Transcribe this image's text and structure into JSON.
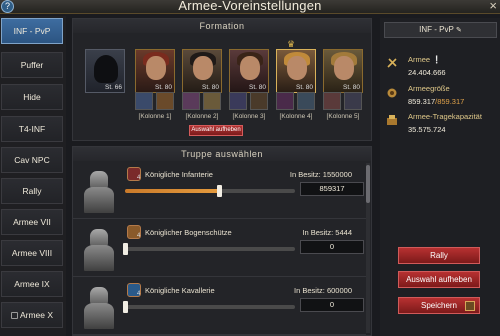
{
  "window": {
    "title": "Armee-Voreinstellungen",
    "help_icon": "?",
    "close_icon": "×"
  },
  "sidebar": {
    "items": [
      {
        "label": "INF - PvP",
        "active": true
      },
      {
        "label": "Puffer"
      },
      {
        "label": "Hide"
      },
      {
        "label": "T4-INF"
      },
      {
        "label": "Cav NPC"
      },
      {
        "label": "Rally"
      },
      {
        "label": "Armee VII"
      },
      {
        "label": "Armee VIII"
      },
      {
        "label": "Armee IX"
      },
      {
        "label": "Armee X",
        "locked": true
      }
    ]
  },
  "formation": {
    "header": "Formation",
    "leader_level": "St. 66",
    "heroes": [
      {
        "level": "St. 80"
      },
      {
        "level": "St. 80"
      },
      {
        "level": "St. 80"
      },
      {
        "level": "St. 80"
      },
      {
        "level": "St. 80"
      }
    ],
    "columns": [
      "[Kolonne 1]",
      "[Kolonne 2]",
      "[Kolonne 3]",
      "[Kolonne 4]",
      "[Kolonne 5]"
    ],
    "deselect_label": "Auswahl aufheben"
  },
  "troops": {
    "header": "Truppe auswählen",
    "rows": [
      {
        "name": "Königliche Infanterie",
        "owned": "In Besitz: 1550000",
        "quantity": "859317",
        "tier": "4",
        "fill_fraction": 0.554
      },
      {
        "name": "Königlicher Bogenschütze",
        "owned": "In Besitz: 5444",
        "quantity": "0",
        "tier": "4",
        "fill_fraction": 0.0
      },
      {
        "name": "Königliche Kavallerie",
        "owned": "In Besitz: 600000",
        "quantity": "0",
        "tier": "4",
        "fill_fraction": 0.0
      }
    ]
  },
  "right": {
    "preset_name": "INF - PvP",
    "army_label": "Armee",
    "army_value": "24.404.666",
    "size_label": "Armeegröße",
    "size_value": "859.317",
    "size_max": "/859.317",
    "capacity_label": "Armee-Tragekapazität",
    "capacity_value": "35.575.724",
    "rally_label": "Rally",
    "deselect_label": "Auswahl aufheben",
    "save_label": "Speichern"
  },
  "colors": {
    "accent_blue": "#3e6da0",
    "accent_red": "#b73131",
    "gold": "#e0b84e"
  }
}
